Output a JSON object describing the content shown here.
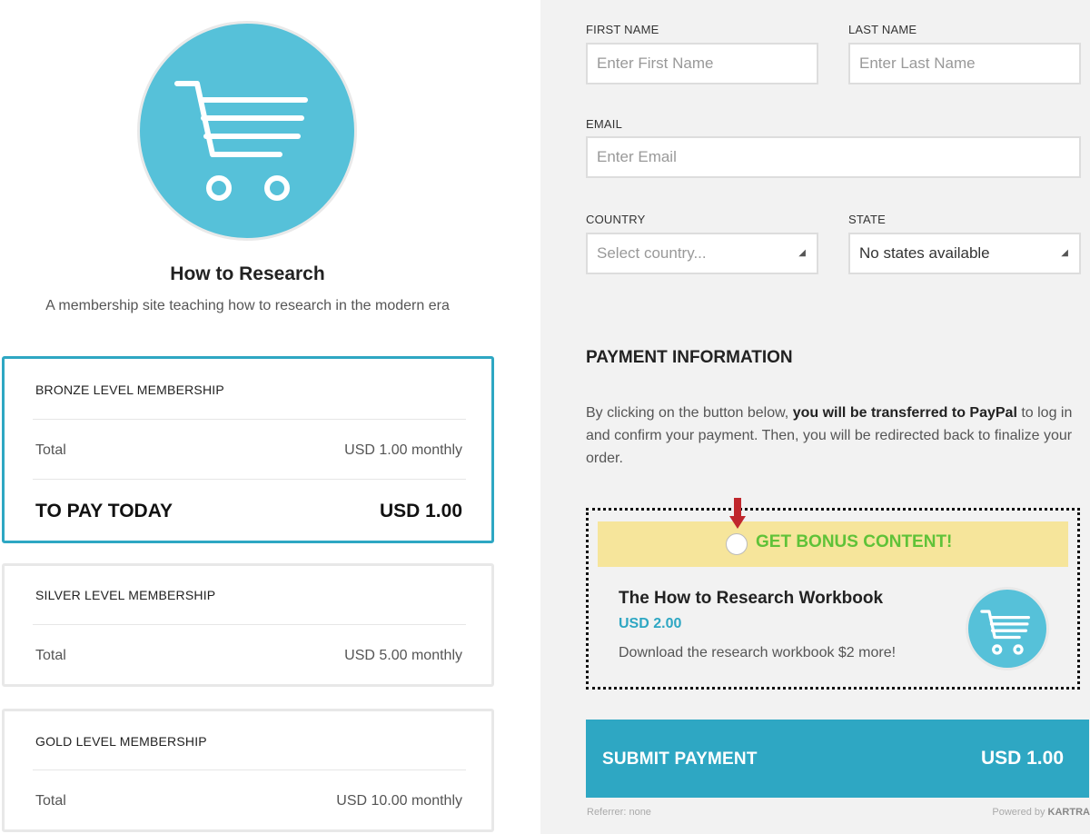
{
  "site": {
    "title": "How to Research",
    "description": "A membership site teaching how to research in the modern era"
  },
  "plans": [
    {
      "name": "BRONZE LEVEL MEMBERSHIP",
      "total_label": "Total",
      "total_value": "USD 1.00 monthly",
      "pay_today_label": "TO PAY TODAY",
      "pay_today_value": "USD 1.00",
      "selected": true
    },
    {
      "name": "SILVER LEVEL MEMBERSHIP",
      "total_label": "Total",
      "total_value": "USD 5.00 monthly"
    },
    {
      "name": "GOLD LEVEL MEMBERSHIP",
      "total_label": "Total",
      "total_value": "USD 10.00 monthly"
    }
  ],
  "form": {
    "first_name": {
      "label": "FIRST NAME",
      "placeholder": "Enter First Name"
    },
    "last_name": {
      "label": "LAST NAME",
      "placeholder": "Enter Last Name"
    },
    "email": {
      "label": "EMAIL",
      "placeholder": "Enter Email"
    },
    "country": {
      "label": "COUNTRY",
      "value": "Select country..."
    },
    "state": {
      "label": "STATE",
      "value": "No states available"
    }
  },
  "payment": {
    "heading": "PAYMENT INFORMATION",
    "info_prefix": "By clicking on the button below, ",
    "info_bold": "you will be transferred to PayPal",
    "info_suffix": " to log in and confirm your payment. Then, you will be redirected back to finalize your order."
  },
  "bonus": {
    "banner": "GET BONUS CONTENT!",
    "title": "The How to Research Workbook",
    "price": "USD 2.00",
    "description": "Download the research workbook $2 more!"
  },
  "submit": {
    "label": "SUBMIT PAYMENT",
    "amount": "USD 1.00"
  },
  "footer": {
    "referrer": "Referrer: none",
    "powered_prefix": "Powered by ",
    "powered_brand": "KARTRA"
  },
  "colors": {
    "accent": "#2ea7c3",
    "logo_bg": "#56c1d9",
    "bonus_banner": "#f6e59b",
    "bonus_text": "#5fc238",
    "arrow": "#c0272d"
  }
}
